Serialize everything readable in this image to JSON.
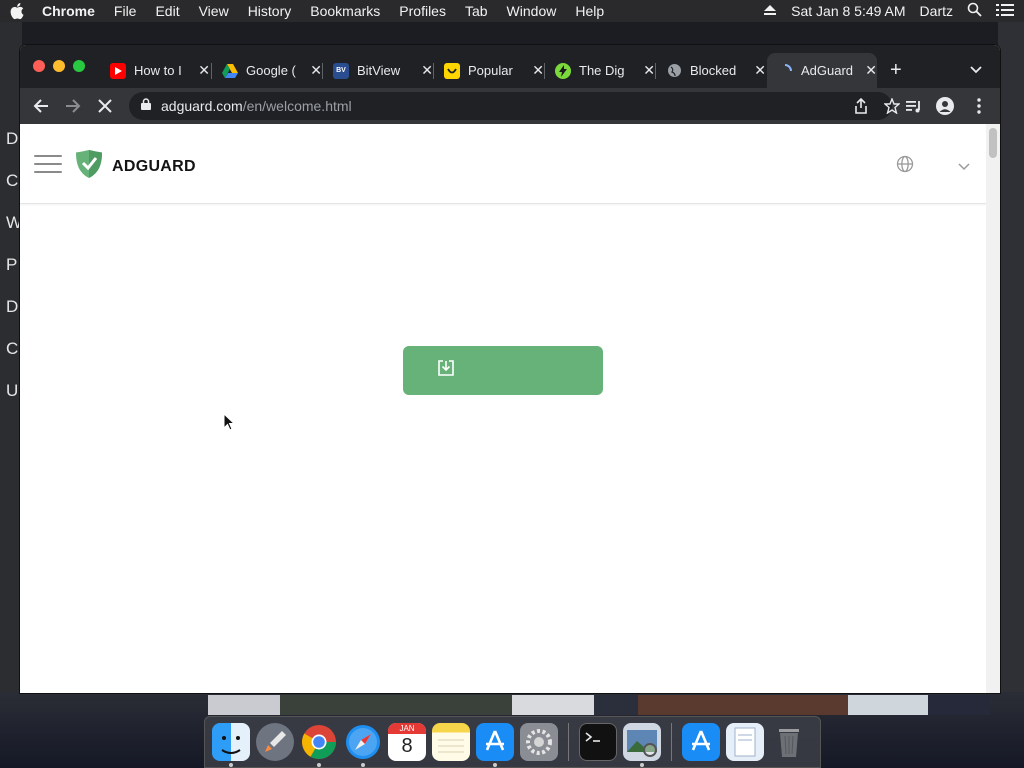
{
  "menubar": {
    "app": "Chrome",
    "items": [
      "File",
      "Edit",
      "View",
      "History",
      "Bookmarks",
      "Profiles",
      "Tab",
      "Window",
      "Help"
    ],
    "datetime": "Sat Jan 8  5:49 AM",
    "user": "Dartz"
  },
  "background_app": {
    "letters": [
      "D",
      "C",
      "W",
      "P",
      "D",
      "C",
      "U"
    ]
  },
  "browser": {
    "tabs": [
      {
        "title": "How to I",
        "icon": "youtube-icon"
      },
      {
        "title": "Google (",
        "icon": "google-drive-icon"
      },
      {
        "title": "BitView",
        "icon": "bitview-icon"
      },
      {
        "title": "Popular",
        "icon": "smiley-icon"
      },
      {
        "title": "The Dig",
        "icon": "bolt-icon"
      },
      {
        "title": "Blocked",
        "icon": "globe-icon"
      },
      {
        "title": "AdGuard",
        "icon": "loading-icon",
        "active": true
      }
    ],
    "url_host": "adguard.com",
    "url_path": "/en/welcome.html"
  },
  "page": {
    "brand": "ADGUARD",
    "brand_color": "#67b279",
    "download_button_label": ""
  },
  "dock": {
    "apps": [
      "Finder",
      "Launchpad",
      "Chrome",
      "Safari",
      "Calendar",
      "Notes",
      "App Store",
      "System Preferences",
      "Terminal",
      "Preview",
      "App Store",
      "Files",
      "Trash"
    ],
    "calendar_month": "JAN",
    "calendar_day": "8"
  }
}
